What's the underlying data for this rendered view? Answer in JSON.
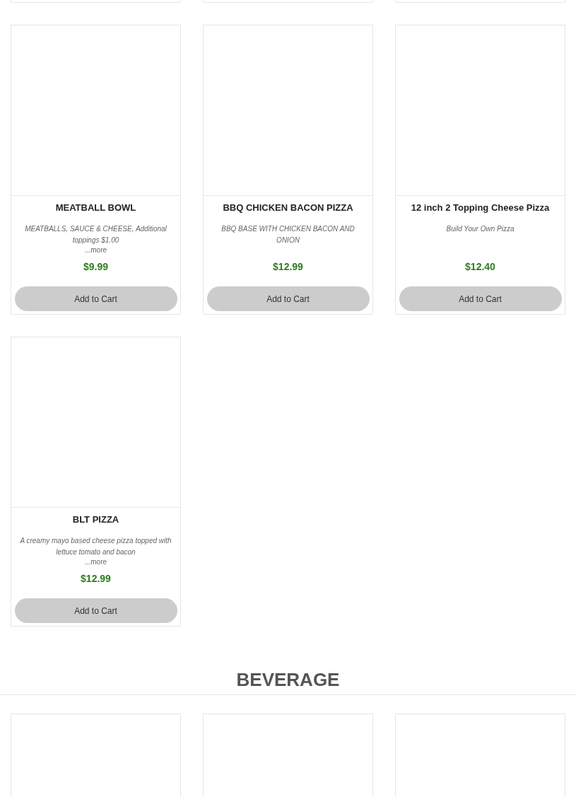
{
  "products": [
    {
      "name": "MEATBALL BOWL",
      "description": "MEATBALLS, SAUCE & CHEESE, Additional toppings $1.00",
      "more": "...more",
      "price": "$9.99",
      "button": "Add to Cart"
    },
    {
      "name": "BBQ CHICKEN BACON PIZZA",
      "description": "BBQ BASE WITH CHICKEN BACON AND ONION",
      "price": "$12.99",
      "button": "Add to Cart"
    },
    {
      "name": "12 inch 2 Topping Cheese Pizza",
      "description": "Build Your Own Pizza",
      "price": "$12.40",
      "button": "Add to Cart"
    },
    {
      "name": "BLT PIZZA",
      "description": "A creamy mayo based cheese pizza topped with lettuce tomato and bacon",
      "more": "...more",
      "price": "$12.99",
      "button": "Add to Cart"
    }
  ],
  "beverage_section": {
    "title": "BEVERAGE"
  }
}
